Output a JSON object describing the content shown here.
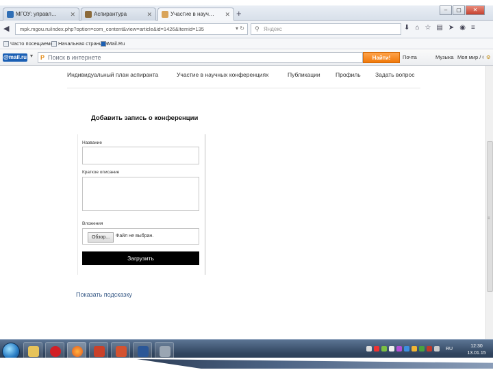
{
  "browser": {
    "tabs": [
      {
        "label": "МГОУ: управление учебно...",
        "active": false
      },
      {
        "label": "Аспирантура",
        "active": false
      },
      {
        "label": "Участие в научных конфе...",
        "active": true
      }
    ],
    "new_tab": "+",
    "window_controls": {
      "minimize": "–",
      "maximize": "▢",
      "close": "✕"
    },
    "url": "mpk.mgou.ru/index.php?option=com_content&view=article&id=1426&Itemid=135",
    "search_placeholder": "Яндекс",
    "bookmarks": [
      "Часто посещаемые",
      "Начальная страница",
      "Mail.Ru"
    ]
  },
  "mailru_bar": {
    "logo": "@mail.ru",
    "search_placeholder": "Поиск в интернете",
    "find_button": "Найти!",
    "links": [
      "Почта",
      "Музыка",
      "Моя мир / ОС"
    ]
  },
  "page": {
    "menu": [
      "Индивидуальный план аспиранта",
      "Участие в научных конференциях",
      "Публикации",
      "Профиль",
      "Задать вопрос"
    ],
    "form_title": "Добавить запись о конференции",
    "fields": {
      "name_label": "Название",
      "description_label": "Краткое описание",
      "attachment_label": "Вложения"
    },
    "file_button": "Обзор...",
    "file_status": "Файл не выбран.",
    "upload_button": "Загрузить",
    "hint_link": "Показать подсказку"
  },
  "taskbar": {
    "lang": "RU",
    "time": "12:30",
    "date": "13.01.15"
  },
  "colors": {
    "accent_orange": "#f0780a",
    "mailru_blue": "#1a5fb4",
    "link": "#3a5c88",
    "button_black": "#000000"
  }
}
